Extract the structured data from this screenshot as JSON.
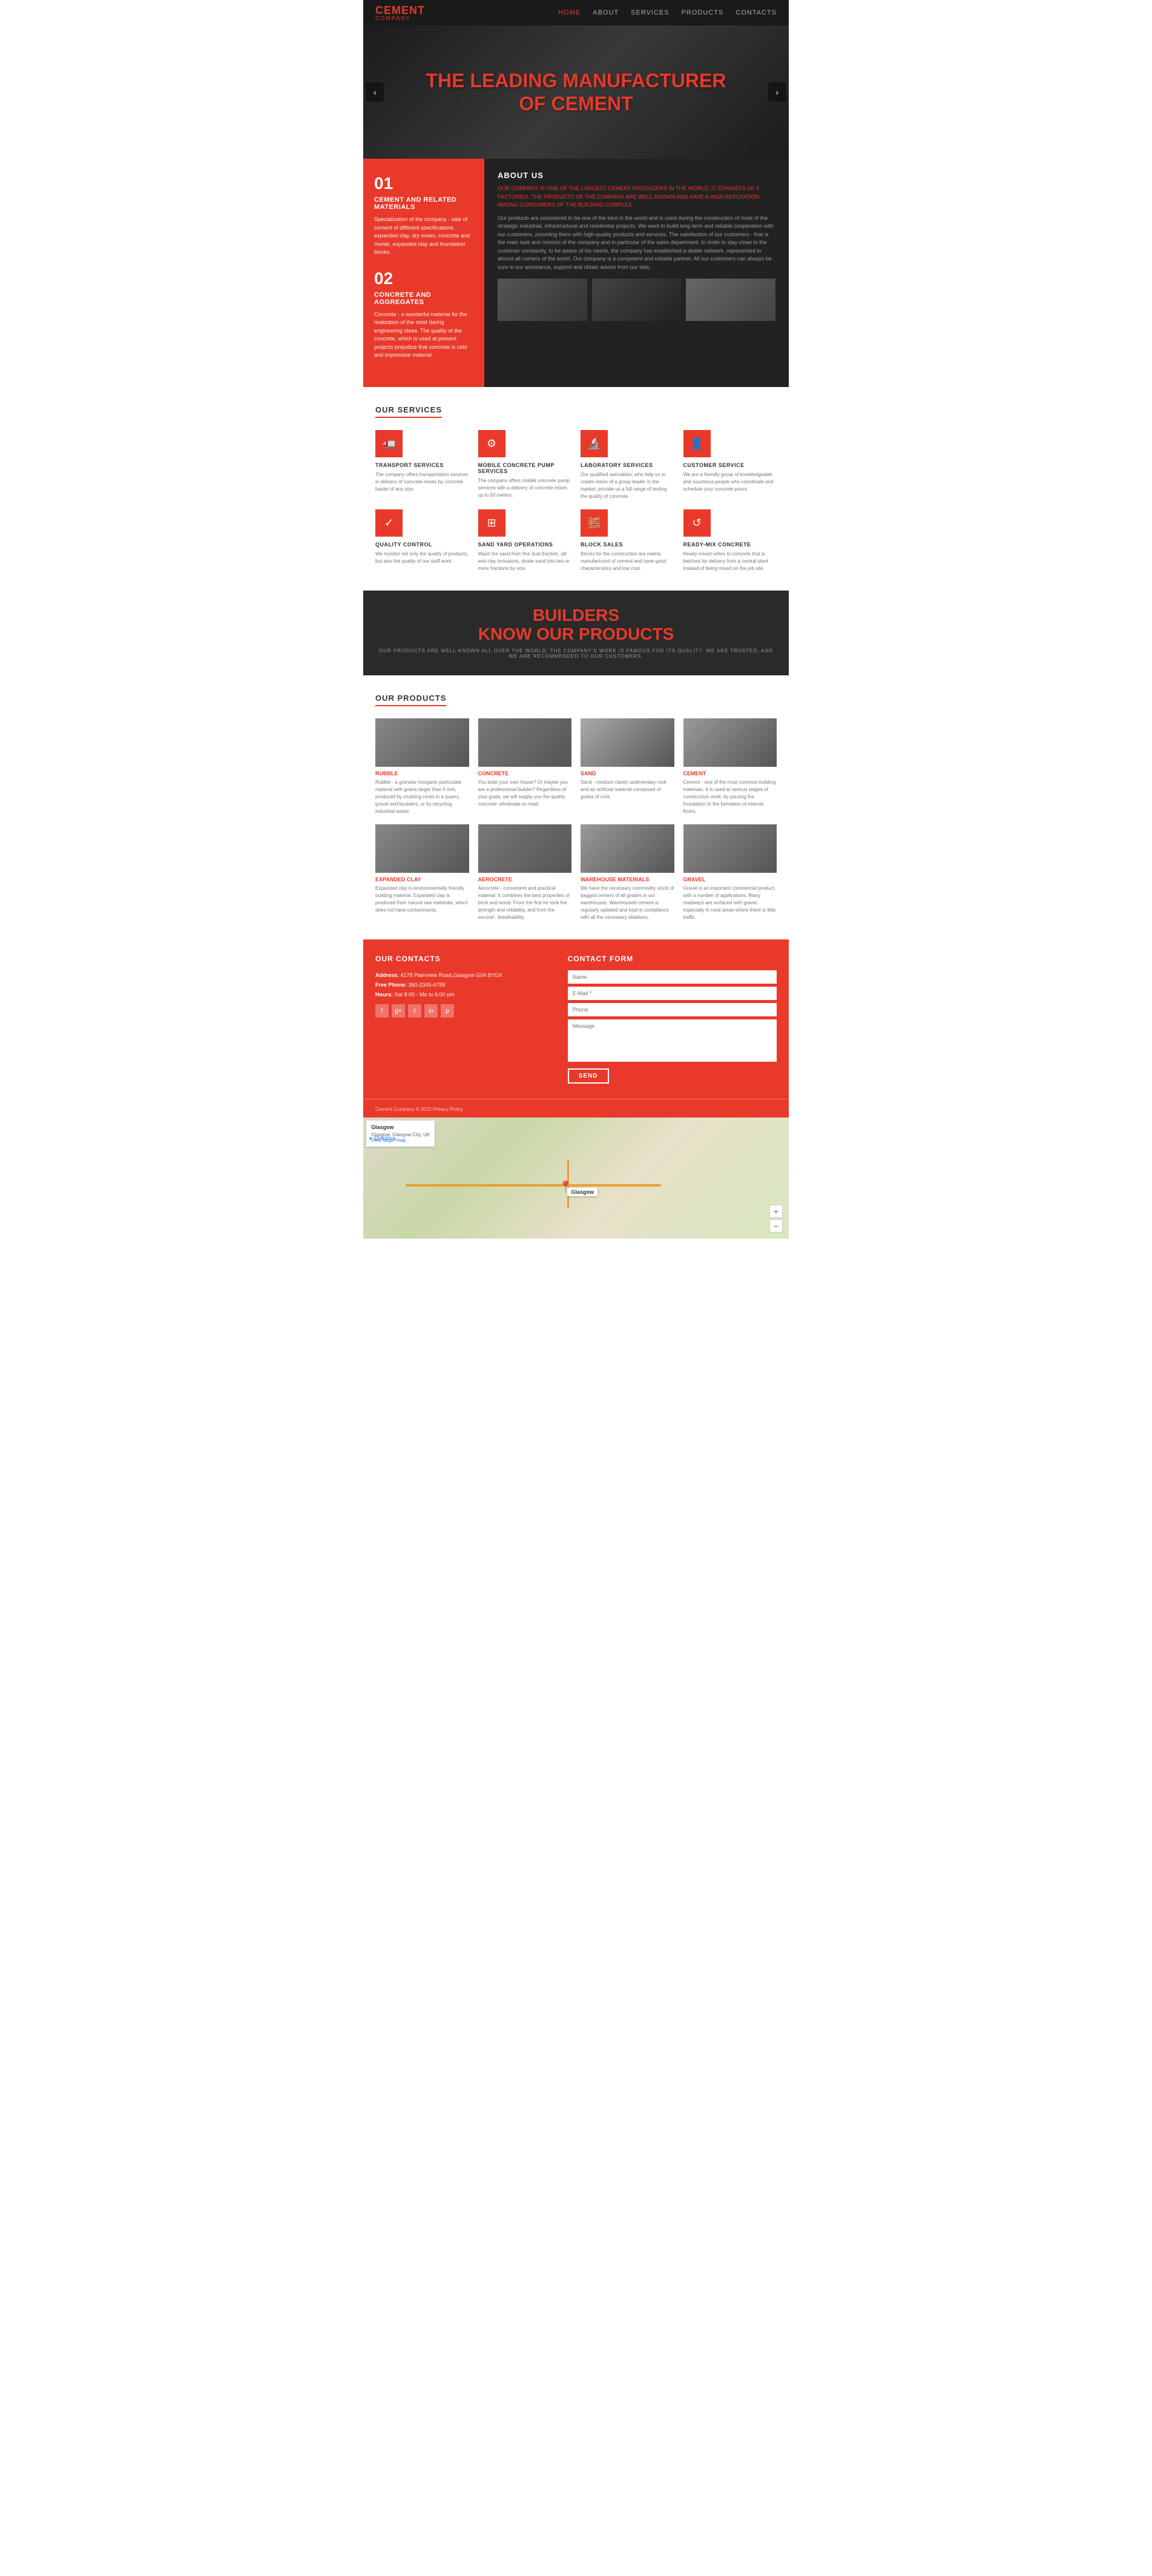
{
  "navbar": {
    "logo_cement": "CEMENT",
    "logo_company": "COMPANY",
    "links": [
      {
        "label": "HOME",
        "active": true
      },
      {
        "label": "ABOUT",
        "active": false
      },
      {
        "label": "SERVICES",
        "active": false
      },
      {
        "label": "PRODUCTS",
        "active": false
      },
      {
        "label": "CONTACTS",
        "active": false
      }
    ]
  },
  "hero": {
    "title_line1": "THE LEADING MANUFACTURER",
    "title_line2": "OF CEMENT",
    "arrow_left": "‹",
    "arrow_right": "›"
  },
  "about": {
    "section_title": "ABOUT US",
    "num1": "01",
    "subtitle1": "CEMENT AND RELATED MATERIALS",
    "desc1": "Specialization of the company - sale of cement of different specifications, expanded clay, dry mixes, concrete and mortar, expanded clay and foundation blocks.",
    "num2": "02",
    "subtitle2": "CONCRETE AND AGGREGATES",
    "desc2": "Concrete - a wonderful material for the realization of the most daring engineering ideas. The quality of the concrete, which is used at present projects prejudice that concrete is cold and impressive material.",
    "intro": "OUR COMPANY IS ONE OF THE LARGEST CEMENT PRODUCERS IN THE WORLD. IT CONSISTS OF 4 FACTORIES. THE PRODUCTS OF THE COMPANY ARE WELL KNOWN AND HAVE A HIGH REPUTATION AMONG CONSUMERS OF THE BUILDING COMPLEX.",
    "body": "Our products are considered to be one of the best in the world and is used during the construction of most of the strategic industrial, infrastructural and residential projects. We want to build long-term and reliable cooperation with our customers, providing them with high-quality products and services. The satisfaction of our customers - that is the main task and mission of the company and in particular of the sales department. In order to stay close to the customer constantly, to be aware of his needs, the company has established a dealer network, represented in almost all corners of the world. Our company is a competent and reliable partner. All our customers can always be sure in our assistance, support and obtain advice from our side."
  },
  "services": {
    "title": "OUR SERVICES",
    "items": [
      {
        "icon": "🚛",
        "name": "TRANSPORT SERVICES",
        "desc": "The company offers transportation services in delivery of concrete-mixes by concrete hauler of any size."
      },
      {
        "icon": "⚙",
        "name": "MOBILE CONCRETE PUMP SERVICES",
        "desc": "The company offers mobile concrete pump services with a delivery of concrete mixes up to 50 meters."
      },
      {
        "icon": "🔬",
        "name": "LABORATORY SERVICES",
        "desc": "Our qualified specialists, who help us to create vision of a group leader in the market, provide us a full range of testing the quality of concrete."
      },
      {
        "icon": "👤",
        "name": "CUSTOMER SERVICE",
        "desc": "We are a friendly group of knowledgeable and courteous people who coordinate and schedule your concrete pours."
      },
      {
        "icon": "✓",
        "name": "QUALITY CONTROL",
        "desc": "We monitor not only the quality of products, but also the quality of our staff work."
      },
      {
        "icon": "⊞",
        "name": "SAND YARD OPERATIONS",
        "desc": "Wash the sand from fine dust fraction, silt and clay inclusions, divide sand into two or more fractions by size."
      },
      {
        "icon": "🧱",
        "name": "BLOCK SALES",
        "desc": "Blocks for the construction are mainly manufactured of cement and have good characteristics and low cost."
      },
      {
        "icon": "↺",
        "name": "READY-MIX CONCRETE",
        "desc": "Ready-mixed refers to concrete that is batched for delivery from a central plant instead of being mixed on the job site."
      }
    ]
  },
  "promo": {
    "title_line1": "BUILDERS",
    "title_line2": "KNOW OUR PRODUCTS",
    "subtitle": "OUR PRODUCTS ARE WELL KNOWN ALL OVER THE WORLD. THE COMPANY'S WORK IS FAMOUS FOR ITS QUALITY. WE ARE TRUSTED, AND WE ARE RECOMMENDED TO OUR CUSTOMERS."
  },
  "products": {
    "title": "OUR PRODUCTS",
    "items": [
      {
        "name": "RUBBLE",
        "desc": "Rubble - a granular inorganic particulate material with grains larger than 5 mm, produced by crushing rocks in a quarry, gravel and boulders, or by recycling industrial waste.",
        "bg": "#888"
      },
      {
        "name": "CONCRETE",
        "desc": "You build your own house? Or maybe you are a professional builder? Regardless of your goals, we will supply you the quality concrete: wholesale or retail.",
        "bg": "#777"
      },
      {
        "name": "SAND",
        "desc": "Sand - medium clastic sedimentary rock and an artificial material composed of grains of rock.",
        "bg": "#999"
      },
      {
        "name": "CEMENT",
        "desc": "Cement - one of the most common building materials. It is used at various stages of construction work: by pouring the foundation to the formation of internal floors.",
        "bg": "#aaa"
      },
      {
        "name": "EXPANDED CLAY",
        "desc": "Expanded clay is environmentally friendly building material. Expanded clay is produced from natural raw materials, which does not have contaminants.",
        "bg": "#888"
      },
      {
        "name": "AEROCRETE",
        "desc": "Aerocrete - convenient and practical material. It combines the best properties of brick and wood. From the first he took the strength and reliability, and from the second - breathability.",
        "bg": "#777"
      },
      {
        "name": "WAREHOUSE MATERIALS",
        "desc": "We have the necessary commodity stock of bagged cement of all grades in our warehouses. Warehoused cement is regularly updated and kept in compliance with all the necessary oblations.",
        "bg": "#999"
      },
      {
        "name": "GRAVEL",
        "desc": "Gravel is an important commercial product, with a number of applications. Many roadways are surfaced with gravel, especially in rural areas where there is little traffic.",
        "bg": "#888"
      }
    ]
  },
  "contacts": {
    "title": "OUR CONTACTS",
    "address_label": "Address:",
    "address_value": "4178 Plainview Road,Glasgow G04 8YGX",
    "phone_label": "Free Phone:",
    "phone_value": "360-2345-6789",
    "hours_label": "Hours:",
    "hours_value": "Sat 8:00 - Mo to 6:00 pm",
    "social_icons": [
      "f",
      "g",
      "t",
      "in",
      "p"
    ],
    "form_title": "CONTACT FORM",
    "name_placeholder": "Name",
    "email_placeholder": "E-Mail *",
    "phone_placeholder": "Phone",
    "message_placeholder": "Message",
    "send_label": "SEND"
  },
  "footer": {
    "copyright": "Cement Company © 2015  Privacy Policy"
  },
  "map": {
    "city_title": "Glasgow",
    "city_sub": "Glasgow, Glasgow City, UK",
    "view_larger": "View larger map",
    "directions": "Directions",
    "label": "Glasgow",
    "zoom_in": "+",
    "zoom_out": "−"
  }
}
